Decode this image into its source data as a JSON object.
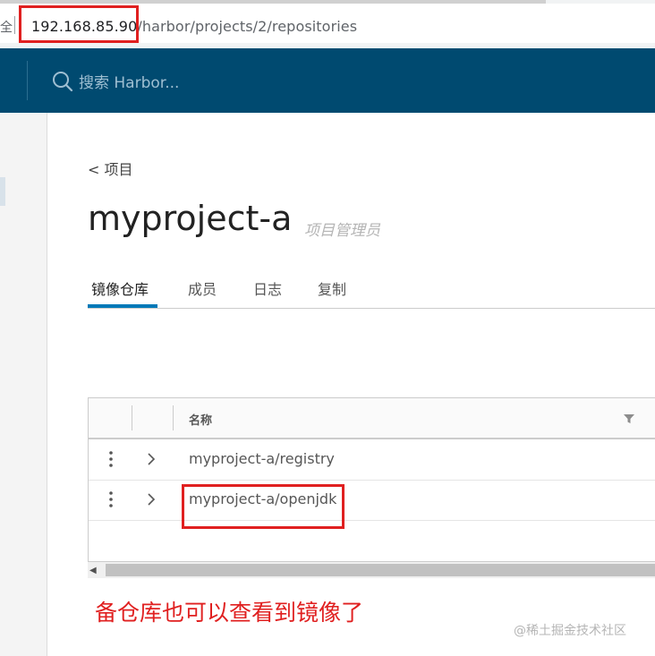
{
  "browser": {
    "url_host": "192.168.85.90",
    "url_path": "/harbor/projects/2/repositories",
    "security_glyph": "全"
  },
  "header": {
    "search_placeholder": "搜索 Harbor..."
  },
  "project": {
    "back_label": "< 项目",
    "name": "myproject-a",
    "role": "项目管理员"
  },
  "tabs": [
    {
      "label": "镜像仓库",
      "active": true
    },
    {
      "label": "成员",
      "active": false
    },
    {
      "label": "日志",
      "active": false
    },
    {
      "label": "复制",
      "active": false
    }
  ],
  "grid": {
    "column_name": "名称",
    "rows": [
      {
        "name": "myproject-a/registry"
      },
      {
        "name": "myproject-a/openjdk"
      }
    ]
  },
  "annotation": {
    "note": "备仓库也可以查看到镜像了",
    "color": "#e02020"
  },
  "watermark": "@稀土掘金技术社区",
  "colors": {
    "header_bg": "#004a70",
    "tab_accent": "#0079b8"
  }
}
